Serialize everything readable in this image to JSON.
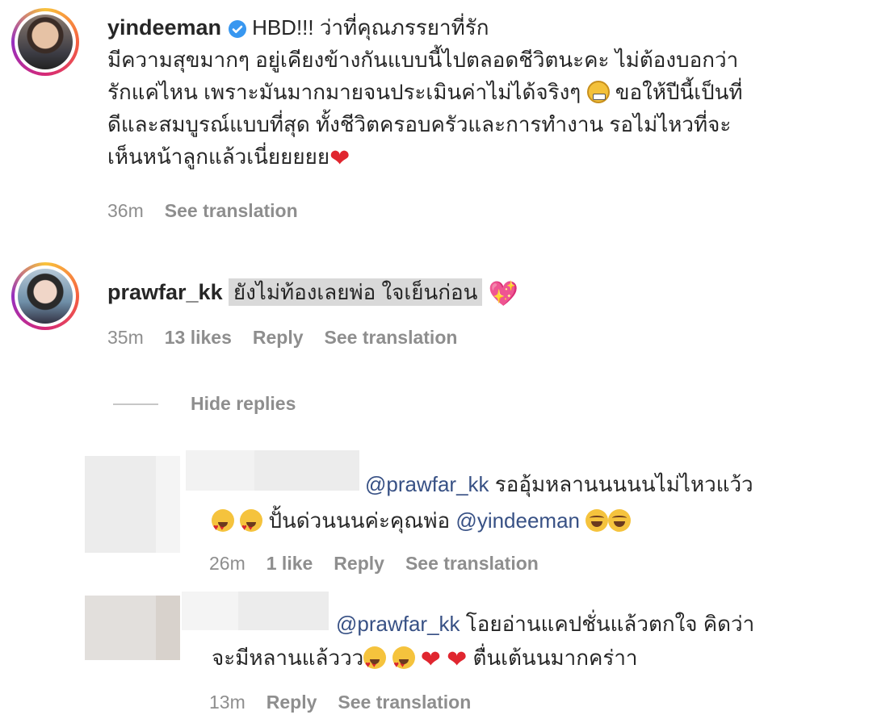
{
  "comment1": {
    "username": "yindeeman",
    "title": "HBD!!! ว่าที่คุณภรรยาที่รัก",
    "line1": "มีความสุขมากๆ อยู่เคียงข้างกันแบบนี้ไปตลอดชีวิตนะคะ ไม่ต้องบอกว่า",
    "line2": "รักแค่ไหน เพราะมันมากมายจนประเมินค่าไม่ได้จริงๆ",
    "line2b": "ขอให้ปีนี้เป็นที่",
    "line3": "ดีและสมบูรณ์แบบที่สุด ทั้งชีวิตครอบครัวและการทำงาน รอไม่ไหวที่จะ",
    "line4": "เห็นหน้าลูกแล้วเนี่ยยยยย",
    "time": "36m",
    "see_translation": "See translation"
  },
  "comment2": {
    "username": "prawfar_kk",
    "text": "ยังไม่ท้องเลยพ่อ ใจเย็นก่อน",
    "time": "35m",
    "likes": "13 likes",
    "reply": "Reply",
    "see_translation": "See translation"
  },
  "hide_replies": "Hide replies",
  "reply1": {
    "mention": "@prawfar_kk",
    "text1": "รออุ้มหลานนนนนไม่ไหวแว้ว",
    "text2": "ปั้นด่วนนนค่ะคุณพ่อ",
    "mention2": "@yindeeman",
    "time": "26m",
    "likes": "1 like",
    "reply": "Reply",
    "see_translation": "See translation"
  },
  "reply2": {
    "mention": "@prawfar_kk",
    "text1": "โอยอ่านแคปชั่นแล้วตกใจ คิดว่า",
    "text2": "จะมีหลานแล้ววว",
    "text3": "ตื่นเต้นนมากคร่าา",
    "time": "13m",
    "reply": "Reply",
    "see_translation": "See translation"
  },
  "colors": {
    "verified": "#3897f0",
    "mention": "#385185",
    "meta": "#8e8e8e"
  }
}
